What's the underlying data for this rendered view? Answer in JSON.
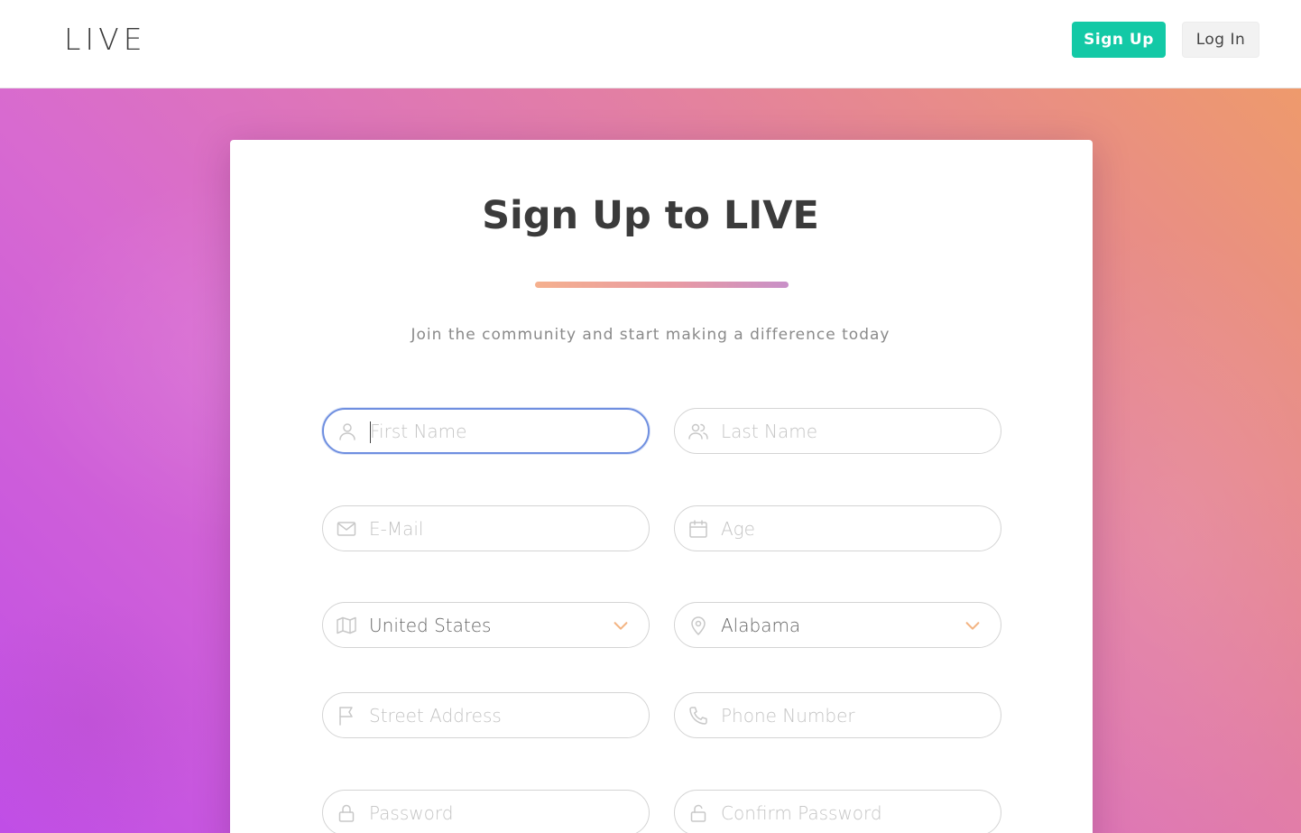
{
  "header": {
    "logo": "LIVE",
    "signup_label": "Sign Up",
    "login_label": "Log In",
    "accent_color": "#13c9a6"
  },
  "form": {
    "title": "Sign Up to LIVE",
    "subtitle": "Join the community and start making a difference today",
    "fields": {
      "first_name": {
        "placeholder": "First Name",
        "icon": "user-icon",
        "focused": true
      },
      "last_name": {
        "placeholder": "Last Name",
        "icon": "users-icon"
      },
      "email": {
        "placeholder": "E-Mail",
        "icon": "mail-icon"
      },
      "age": {
        "placeholder": "Age",
        "icon": "calendar-icon"
      },
      "country": {
        "value": "United States",
        "icon": "map-icon"
      },
      "state": {
        "value": "Alabama",
        "icon": "map-pin-icon"
      },
      "street": {
        "placeholder": "Street Address",
        "icon": "flag-icon"
      },
      "phone": {
        "placeholder": "Phone Number",
        "icon": "phone-icon"
      },
      "password": {
        "placeholder": "Password",
        "icon": "lock-icon"
      },
      "confirm_password": {
        "placeholder": "Confirm Password",
        "icon": "unlock-icon"
      }
    }
  }
}
